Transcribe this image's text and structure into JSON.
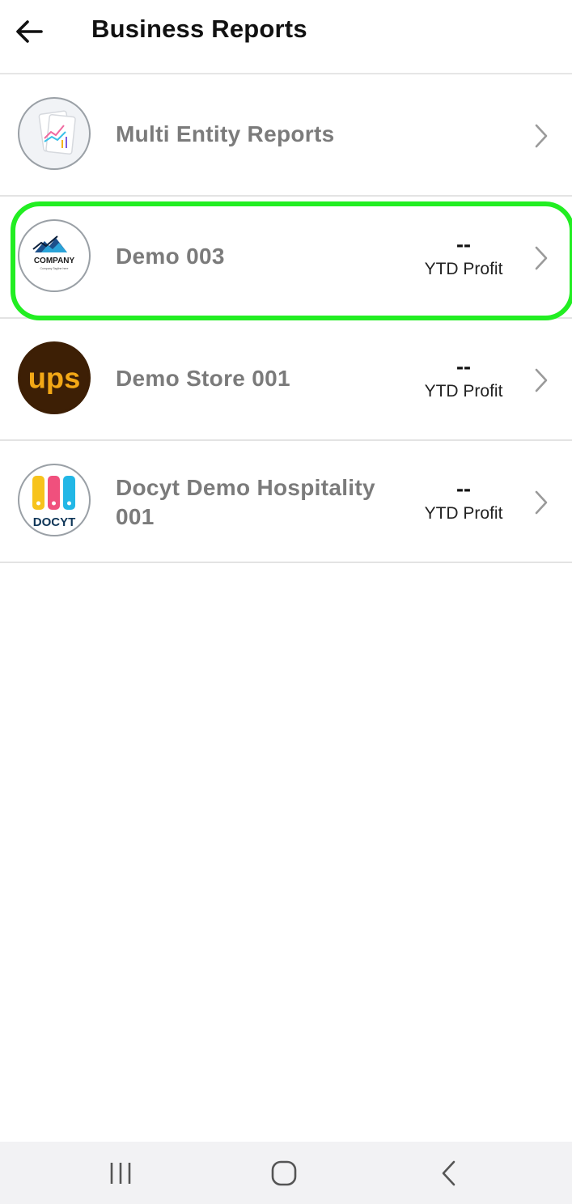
{
  "header": {
    "title": "Business Reports",
    "back_icon": "arrow-left-icon"
  },
  "businesses": [
    {
      "name": "Multi Entity Reports",
      "icon": "reports-chart-icon",
      "has_metric": false
    },
    {
      "name": "Demo 003",
      "icon": "company-logo",
      "logo_text": "COMPANY",
      "logo_tagline": "Company Tagline here",
      "metric_value": "--",
      "metric_label": "YTD Profit",
      "highlighted": true
    },
    {
      "name": "Demo Store 001",
      "icon": "ups-logo",
      "logo_text": "ups",
      "metric_value": "--",
      "metric_label": "YTD Profit"
    },
    {
      "name_line1": "Docyt Demo Hospitality",
      "name_line2": "001",
      "icon": "docyt-logo",
      "logo_text": "DOCYT",
      "metric_value": "--",
      "metric_label": "YTD Profit"
    }
  ],
  "navbar": {
    "recents_icon": "recent-apps-icon",
    "home_icon": "home-icon",
    "back_icon": "back-chevron-icon"
  },
  "colors": {
    "highlight": "#22ee22",
    "name_text": "#7b7b7b",
    "ups_brown": "#3d1f05",
    "ups_gold": "#f3a816",
    "docyt_yellow": "#f7c31c",
    "docyt_pink": "#f0507d",
    "docyt_cyan": "#22b7e6",
    "docyt_navy": "#0e3557"
  }
}
